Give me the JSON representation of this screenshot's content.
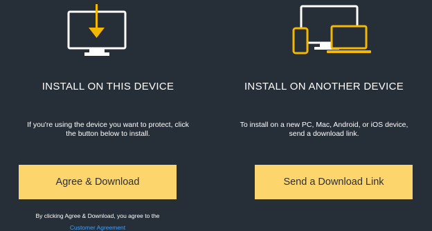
{
  "colors": {
    "background": "#262e38",
    "accent": "#fdd56d",
    "illustration_line": "#ffffff",
    "illustration_accent": "#f5b800",
    "link": "#3ea1ff"
  },
  "left": {
    "icon": "monitor-download-icon",
    "heading": "INSTALL ON THIS DEVICE",
    "desc_line1": "If you're using the device you want to protect, click",
    "desc_line2": "the button below to install.",
    "button_label": "Agree & Download",
    "legal_text": "By clicking Agree & Download, you agree to the",
    "legal_link": "Customer Agreement"
  },
  "right": {
    "icon": "multi-device-icon",
    "heading": "INSTALL ON ANOTHER DEVICE",
    "desc_line1": "To install on a new PC, Mac, Android, or iOS device,",
    "desc_line2": "send a download link.",
    "button_label": "Send a Download Link"
  }
}
